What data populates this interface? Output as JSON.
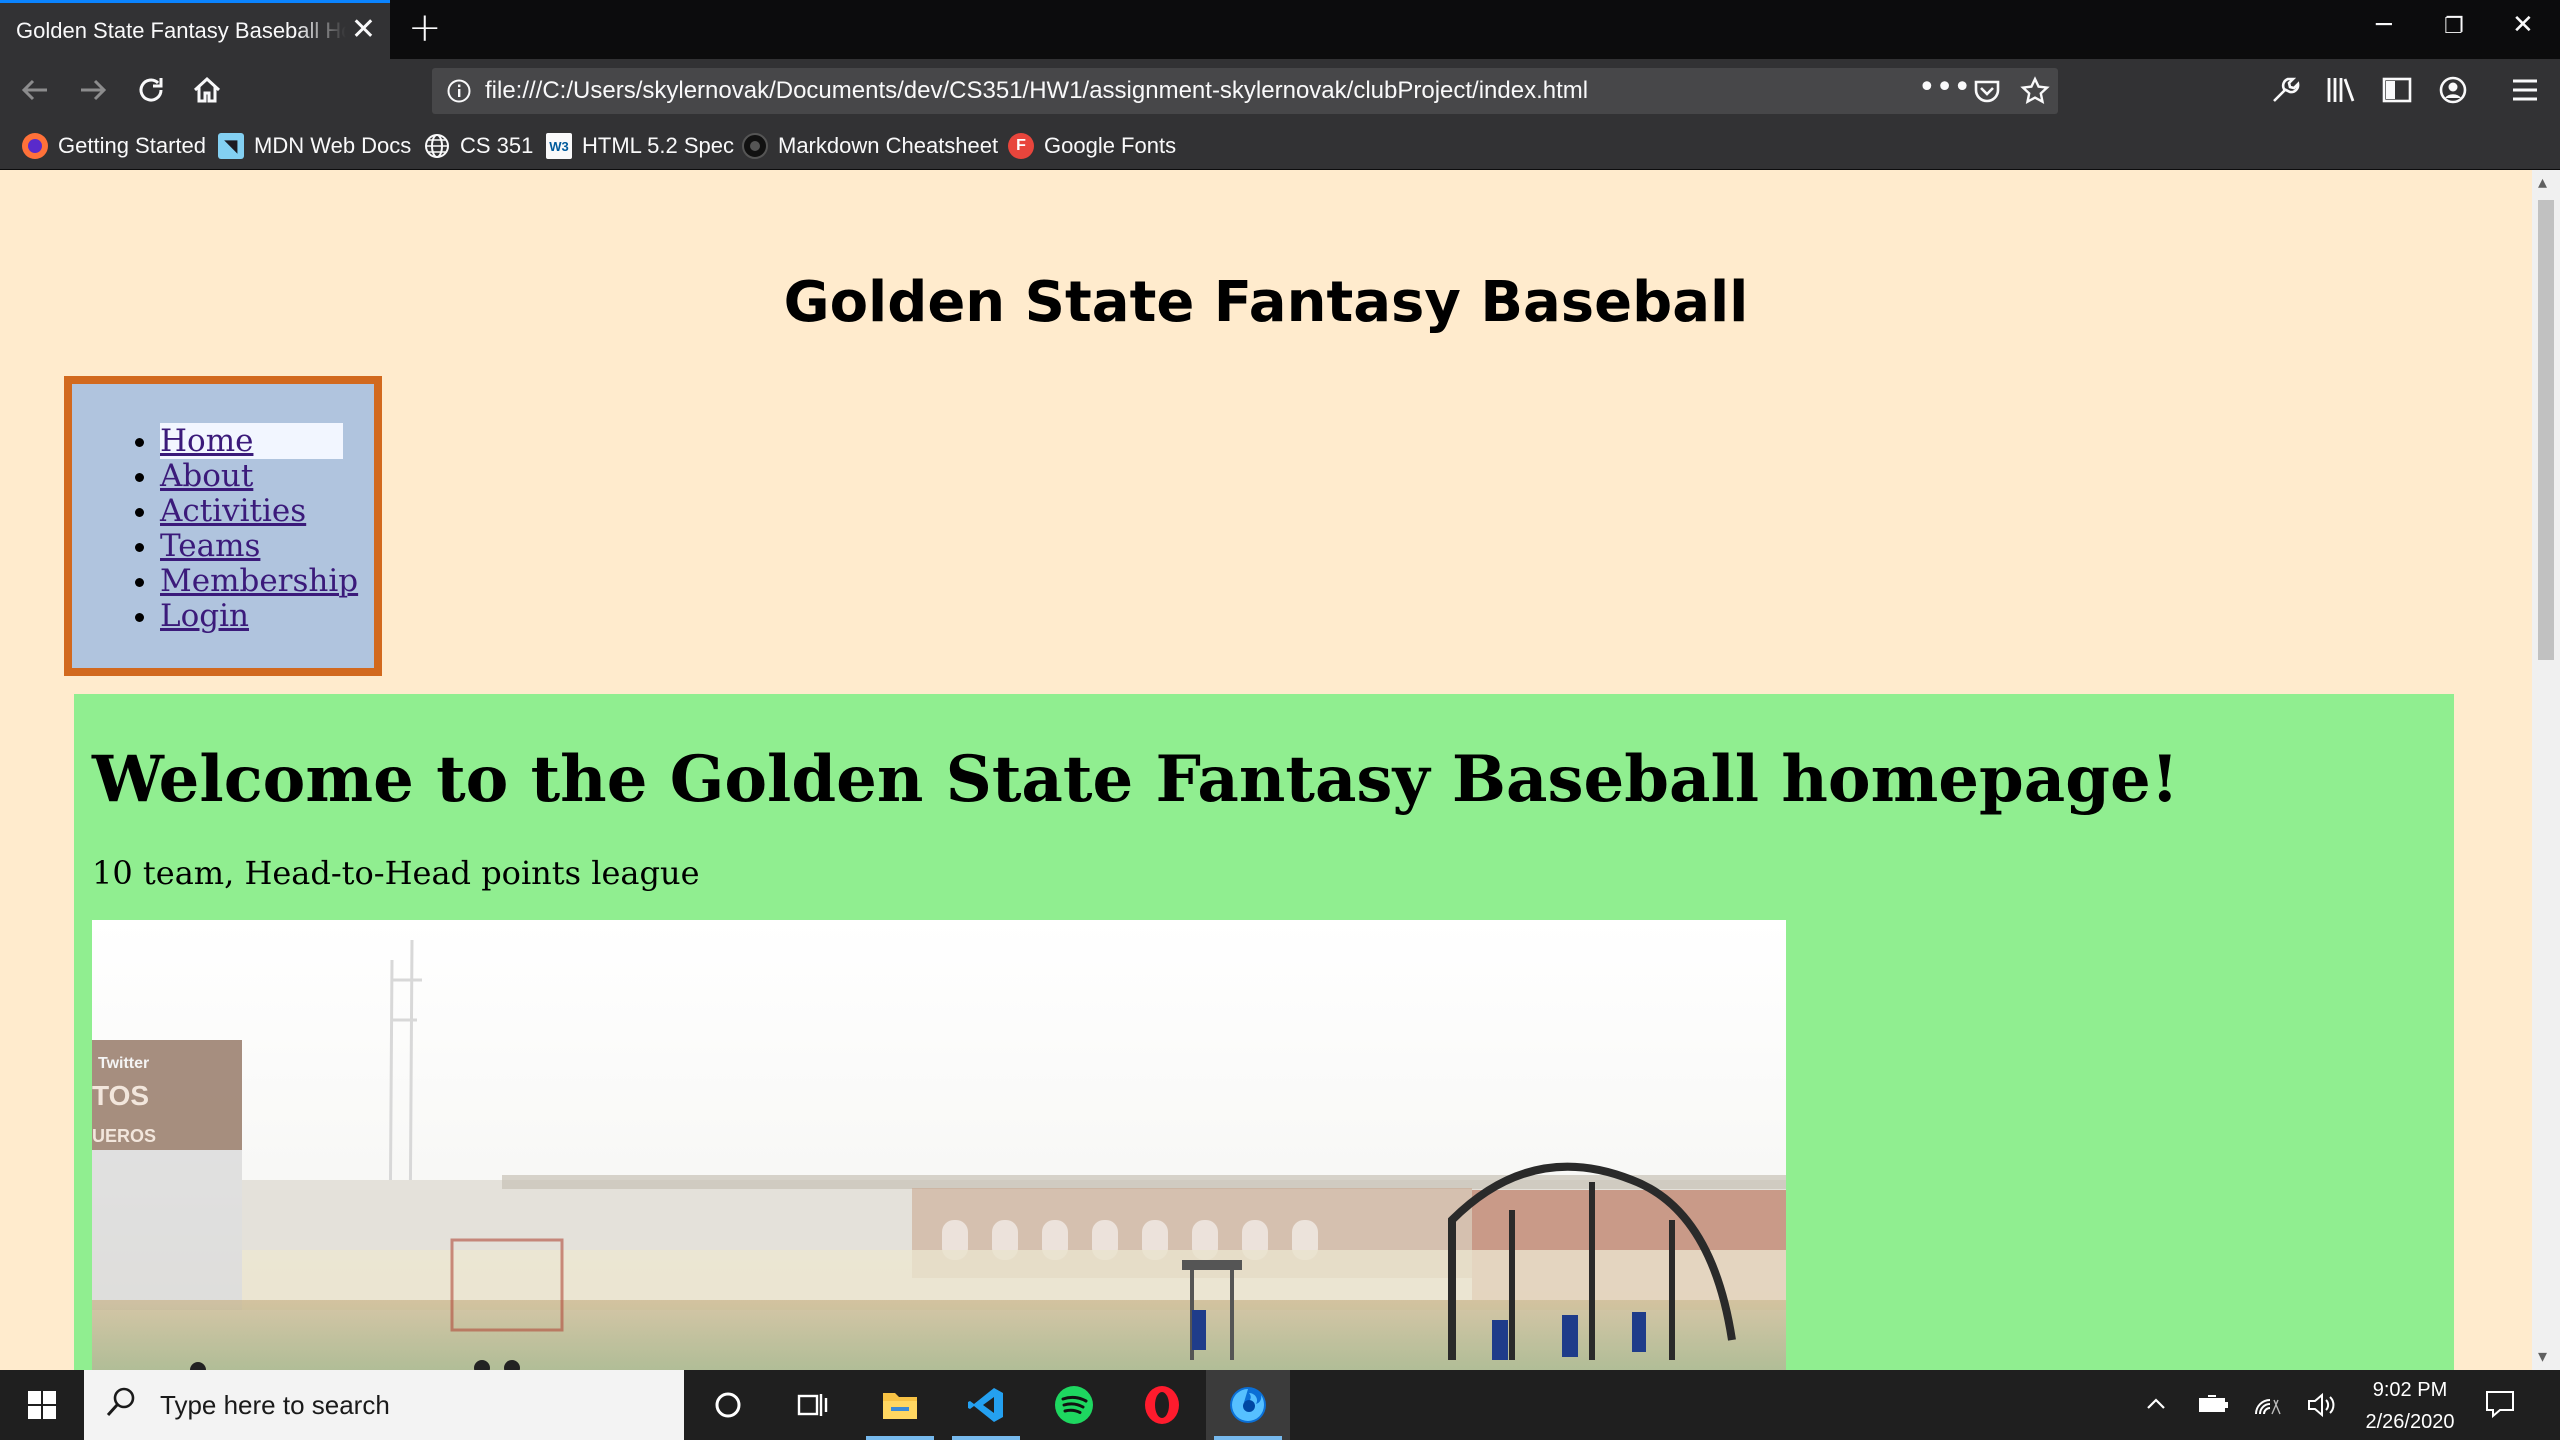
{
  "browser": {
    "tab_title": "Golden State Fantasy Baseball Homepage",
    "url": "file:///C:/Users/skylernovak/Documents/dev/CS351/HW1/assignment-skylernovak/clubProject/index.html",
    "bookmarks": [
      {
        "label": "Getting Started",
        "icon": "firefox-icon"
      },
      {
        "label": "MDN Web Docs",
        "icon": "mdn-icon"
      },
      {
        "label": "CS 351",
        "icon": "globe-icon"
      },
      {
        "label": "HTML 5.2 Spec",
        "icon": "w3c-icon"
      },
      {
        "label": "Markdown Cheatsheet",
        "icon": "github-icon"
      },
      {
        "label": "Google Fonts",
        "icon": "google-fonts-icon"
      }
    ]
  },
  "page": {
    "site_title": "Golden State Fantasy Baseball",
    "nav": [
      "Home",
      "About",
      "Activities",
      "Teams",
      "Membership",
      "Login"
    ],
    "welcome_heading": "Welcome to the Golden State Fantasy Baseball homepage!",
    "subtitle": "10 team, Head-to-Head points league",
    "photo_sign_text": [
      "Twitter",
      "TOS",
      "UEROS"
    ],
    "colors": {
      "page_bg": "#ffebcd",
      "nav_bg": "#b0c4de",
      "nav_border": "#d2691e",
      "main_bg": "#90ee90"
    }
  },
  "taskbar": {
    "search_placeholder": "Type here to search",
    "time": "9:02 PM",
    "date": "2/26/2020"
  }
}
